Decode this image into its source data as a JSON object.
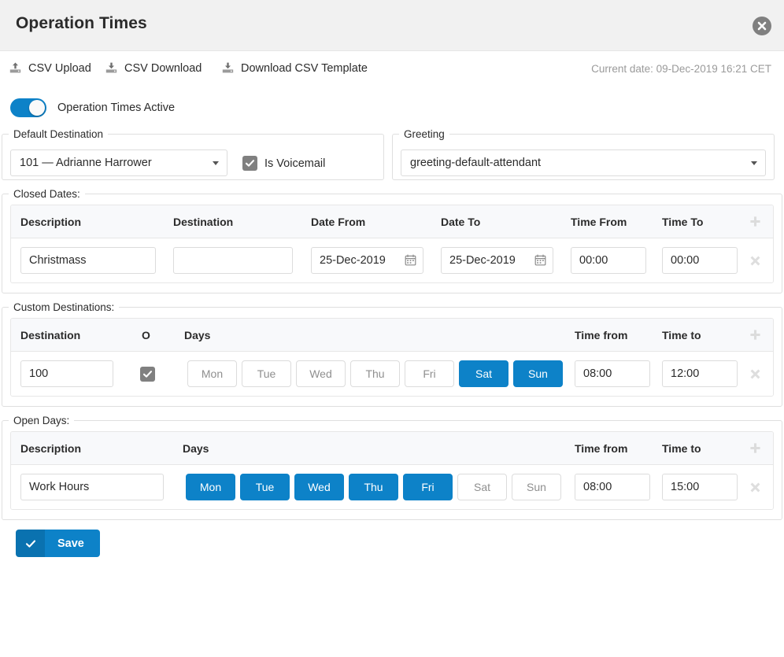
{
  "window": {
    "title": "Operation Times",
    "close_icon": "close-circle-icon"
  },
  "toolbar": {
    "links": [
      {
        "label": "CSV Upload",
        "icon": "upload-icon"
      },
      {
        "label": "CSV Download",
        "icon": "download-icon"
      },
      {
        "label": "Download CSV Template",
        "icon": "download-icon"
      }
    ],
    "current_date": "Current date: 09-Dec-2019 16:21 CET"
  },
  "active_toggle": {
    "label": "Operation Times Active",
    "on": true
  },
  "default_destination": {
    "legend": "Default Destination",
    "value": "101  —  Adrianne Harrower",
    "voicemail_label": "Is Voicemail",
    "voicemail_checked": true
  },
  "greeting": {
    "legend": "Greeting",
    "value": "greeting-default-attendant"
  },
  "closed_dates": {
    "legend": "Closed Dates:",
    "columns": [
      "Description",
      "Destination",
      "Date From",
      "Date To",
      "Time From",
      "Time To"
    ],
    "add_icon": "plus-icon",
    "rows": [
      {
        "description": "Christmass",
        "destination": "",
        "date_from": "25-Dec-2019",
        "date_to": "25-Dec-2019",
        "time_from": "00:00",
        "time_to": "00:00",
        "delete_icon": "close-x-icon"
      }
    ]
  },
  "custom_destinations": {
    "legend": "Custom Destinations:",
    "columns": [
      "Destination",
      "O",
      "Days",
      "Time from",
      "Time to"
    ],
    "add_icon": "plus-icon",
    "day_names": [
      "Mon",
      "Tue",
      "Wed",
      "Thu",
      "Fri",
      "Sat",
      "Sun"
    ],
    "rows": [
      {
        "destination": "100",
        "checked": true,
        "days_active": [
          false,
          false,
          false,
          false,
          false,
          true,
          true
        ],
        "time_from": "08:00",
        "time_to": "12:00",
        "delete_icon": "close-x-icon"
      }
    ]
  },
  "open_days": {
    "legend": "Open Days:",
    "columns": [
      "Description",
      "Days",
      "Time from",
      "Time to"
    ],
    "add_icon": "plus-icon",
    "day_names": [
      "Mon",
      "Tue",
      "Wed",
      "Thu",
      "Fri",
      "Sat",
      "Sun"
    ],
    "rows": [
      {
        "description": "Work Hours",
        "days_active": [
          true,
          true,
          true,
          true,
          true,
          false,
          false
        ],
        "time_from": "08:00",
        "time_to": "15:00",
        "delete_icon": "close-x-icon"
      }
    ]
  },
  "save": {
    "label": "Save",
    "icon": "check-icon"
  },
  "colors": {
    "accent_blue": "#0d82c8",
    "accent_blue_dark": "#0a72b0",
    "titlebar_bg": "#f1f1f1",
    "table_header_bg": "#f8f9fb",
    "muted_text": "#9a9a9a",
    "checkbox_gray": "#808080"
  }
}
